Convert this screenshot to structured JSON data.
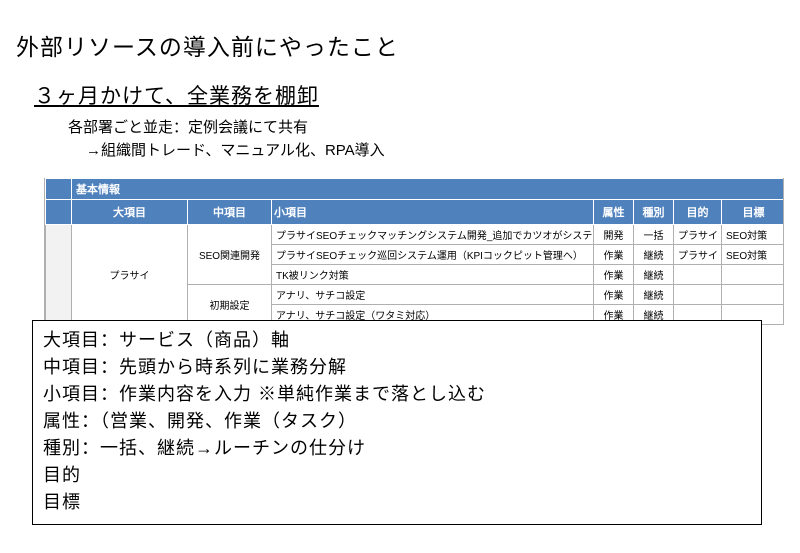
{
  "title": "外部リソースの導入前にやったこと",
  "subtitle": "３ヶ月かけて、全業務を棚卸",
  "sub1": "各部署ごと並走：定例会議にて共有",
  "sub2": "→組織間トレード、マニュアル化、RPA導入",
  "section_header": "基本情報",
  "cols": {
    "a": "大項目",
    "b": "中項目",
    "c": "小項目",
    "d": "属性",
    "e": "種別",
    "f": "目的",
    "g": "目標"
  },
  "rows": [
    {
      "big": "プラサイ",
      "mid": "SEO関連開発",
      "small": "プラサイSEOチェックマッチングシステム開発_追加でカツオがシステ",
      "attr": "開発",
      "kind": "一括",
      "goal": "プラサイ",
      "target": "SEO対策"
    },
    {
      "big": "",
      "mid": "",
      "small": "プラサイSEOチェック巡回システム運用（KPIコックピット管理へ）",
      "attr": "作業",
      "kind": "継続",
      "goal": "プラサイ",
      "target": "SEO対策"
    },
    {
      "big": "",
      "mid": "",
      "small": "TK被リンク対策",
      "attr": "作業",
      "kind": "継続",
      "goal": "",
      "target": ""
    },
    {
      "big": "",
      "mid": "初期設定",
      "small": "アナリ、サチコ設定",
      "attr": "作業",
      "kind": "継続",
      "goal": "",
      "target": ""
    },
    {
      "big": "",
      "mid": "",
      "small": "アナリ、サチコ設定（ワタミ対応）",
      "attr": "作業",
      "kind": "継続",
      "goal": "",
      "target": ""
    }
  ],
  "defs": [
    "大項目：サービス（商品）軸",
    "中項目：先頭から時系列に業務分解",
    "小項目：作業内容を入力 ※単純作業まで落とし込む",
    "属性：（営業、開発、作業（タスク）",
    "種別：一括、継続→ルーチンの仕分け",
    "目的",
    "目標"
  ]
}
